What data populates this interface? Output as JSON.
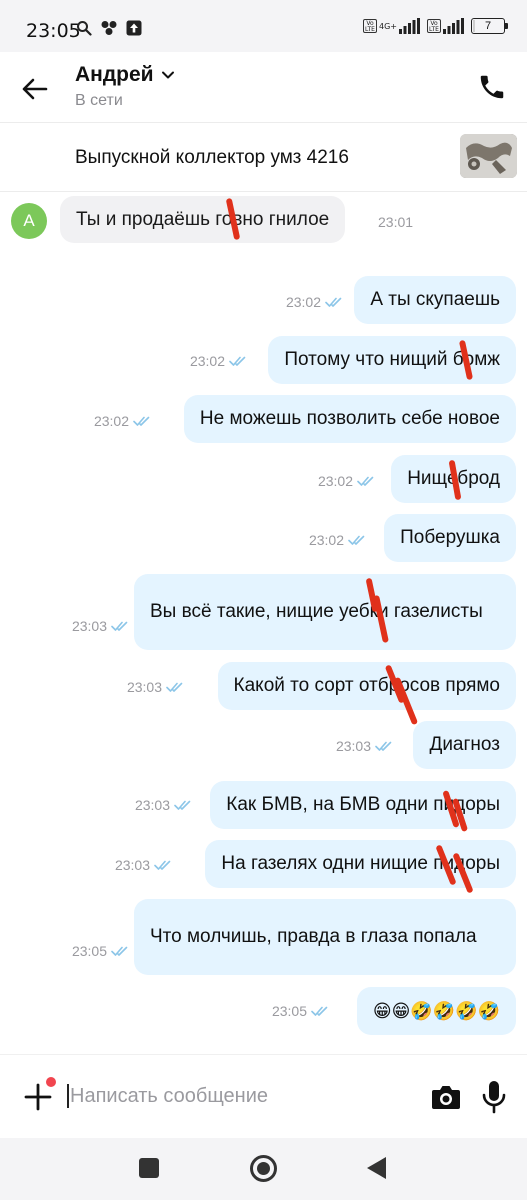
{
  "status_bar": {
    "time": "23:05",
    "network_label": "4G+",
    "volte_label": "Vo LTE",
    "battery": "7",
    "battery_level_percent": 7,
    "icons": [
      "search-icon",
      "app-cluster-icon",
      "upload-icon",
      "signal-icon",
      "battery-icon"
    ]
  },
  "header": {
    "contact_name": "Андрей",
    "status": "В сети",
    "icons": [
      "back-arrow-icon",
      "chevron-down-icon",
      "phone-icon"
    ]
  },
  "item": {
    "title": "Выпускной коллектор умз 4216"
  },
  "messages": {
    "incoming": [
      {
        "avatar": "А",
        "text": "Ты и продаёшь говно гнилое",
        "time": "23:01"
      }
    ],
    "outgoing": [
      {
        "text": "А ты скупаешь",
        "time": "23:02"
      },
      {
        "text": "Потому что нищий бомж",
        "time": "23:02"
      },
      {
        "text": "Не можешь позволить себе новое",
        "time": "23:02"
      },
      {
        "text": "Нищеброд",
        "time": "23:02"
      },
      {
        "text": "Поберушка",
        "time": "23:02"
      },
      {
        "text": "Вы всё такие, нищие уебки газелисты",
        "time": "23:03"
      },
      {
        "text": "Какой то сорт отбросов прямо",
        "time": "23:03"
      },
      {
        "text": "Диагноз",
        "time": "23:03"
      },
      {
        "text": "Как БМВ, на БМВ одни пидоры",
        "time": "23:03"
      },
      {
        "text": "На газелях одни  нищие пидоры",
        "time": "23:03"
      },
      {
        "text": "Что молчишь, правда в глаза попала",
        "time": "23:05"
      },
      {
        "text": "😁😁🤣🤣🤣🤣",
        "time": "23:05"
      }
    ]
  },
  "input": {
    "placeholder": "Написать сообщение",
    "icons": [
      "plus-icon",
      "camera-icon",
      "microphone-icon"
    ]
  },
  "colors": {
    "outgoing_bubble": "#e4f4ff",
    "incoming_bubble": "#f1f1f3",
    "avatar": "#7cc85a",
    "read_ticks": "#8cc6e8",
    "redaction_marks": "#e0311b",
    "notification_dot": "#f1454f"
  }
}
